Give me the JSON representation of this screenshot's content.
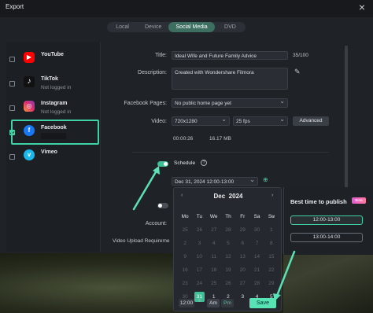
{
  "window": {
    "title": "Export"
  },
  "tabs": [
    "Local",
    "Device",
    "Social Media",
    "DVD"
  ],
  "active_tab": "Social Media",
  "platforms": [
    {
      "name": "YouTube",
      "status": "",
      "checked": false,
      "color": "#ff0000",
      "icon": "youtube-icon"
    },
    {
      "name": "TikTok",
      "status": "Not logged in",
      "checked": false,
      "color": "#111111",
      "icon": "tiktok-icon"
    },
    {
      "name": "Instagram",
      "status": "Not logged in",
      "checked": false,
      "color": "#d6249f",
      "icon": "instagram-icon"
    },
    {
      "name": "Facebook",
      "status": "",
      "checked": true,
      "color": "#1877f2",
      "icon": "facebook-icon"
    },
    {
      "name": "Vimeo",
      "status": "",
      "checked": false,
      "color": "#1ab7ea",
      "icon": "vimeo-icon"
    }
  ],
  "form": {
    "title_label": "Title:",
    "title_value": "Ideal Wife and Future Family Advice",
    "title_count": "35/100",
    "description_label": "Description:",
    "description_value": "Created with Wondershare Filmora",
    "pages_label": "Facebook Pages:",
    "pages_value": "No public home page yet",
    "video_label": "Video:",
    "resolution": "720x1280",
    "fps": "25 fps",
    "advanced_label": "Advanced",
    "duration": "00:00:26",
    "size": "16.17 MB",
    "schedule_label": "Schedule",
    "schedule_info": "?",
    "schedule_value": "Dec 31, 2024  12:00-13:00",
    "account_label": "Account:",
    "requirement_label": "Video Upload Requireme"
  },
  "calendar": {
    "month": "Dec",
    "year": "2024",
    "weekdays": [
      "Mo",
      "Tu",
      "We",
      "Th",
      "Fr",
      "Sa",
      "Su"
    ],
    "weeks": [
      [
        "25",
        "26",
        "27",
        "28",
        "29",
        "30",
        "1"
      ],
      [
        "2",
        "3",
        "4",
        "5",
        "6",
        "7",
        "8"
      ],
      [
        "9",
        "10",
        "11",
        "12",
        "13",
        "14",
        "15"
      ],
      [
        "16",
        "17",
        "18",
        "19",
        "20",
        "21",
        "22"
      ],
      [
        "23",
        "24",
        "25",
        "26",
        "27",
        "28",
        "29"
      ],
      [
        "30",
        "31",
        "1",
        "2",
        "3",
        "4",
        "5"
      ]
    ],
    "selected_day": "31",
    "hour": "12",
    "minute": "00",
    "am_label": "Am",
    "pm_label": "Pm",
    "save_label": "Save"
  },
  "best_time": {
    "title": "Best time to publish",
    "badge": "Beta",
    "slots": [
      "12:00-13:00",
      "13:00-14:00"
    ],
    "active_slot": "12:00-13:00"
  },
  "colors": {
    "accent": "#3fd2a6",
    "annotation": "#5ce0b6"
  }
}
